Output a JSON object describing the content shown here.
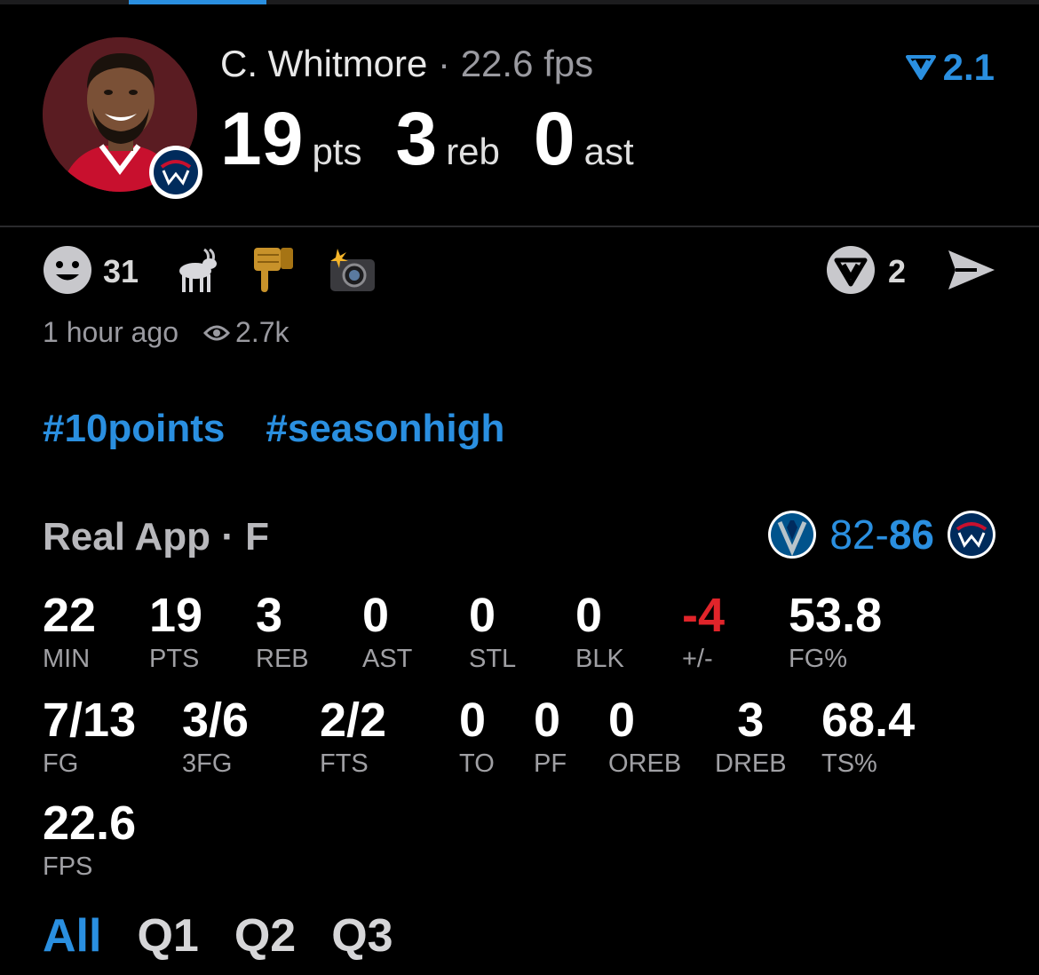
{
  "player": {
    "name": "C. Whitmore",
    "separator": " · ",
    "fps": "22.6 fps",
    "team_colors": {
      "jersey": "#c8102e",
      "badge": "#002b5c"
    }
  },
  "rating": {
    "icon": "real-app-v-icon",
    "value": "2.1"
  },
  "headline": [
    {
      "value": "19",
      "label": "pts"
    },
    {
      "value": "3",
      "label": "reb"
    },
    {
      "value": "0",
      "label": "ast"
    }
  ],
  "reactions": {
    "count": "31",
    "icons": [
      "smiley-icon",
      "goat-icon",
      "thumbs-down-icon",
      "camera-flash-icon"
    ],
    "comments": "2"
  },
  "meta": {
    "time": "1 hour ago",
    "views": "2.7k"
  },
  "hashtags": [
    "#10points",
    "#seasonhigh"
  ],
  "game": {
    "source": "Real App · F",
    "score_away": "82",
    "score_dash": "-",
    "score_home": "86",
    "away_team_icon": "mavericks-logo",
    "home_team_icon": "wizards-logo"
  },
  "stats_row1": [
    {
      "value": "22",
      "label": "MIN"
    },
    {
      "value": "19",
      "label": "PTS"
    },
    {
      "value": "3",
      "label": "REB"
    },
    {
      "value": "0",
      "label": "AST"
    },
    {
      "value": "0",
      "label": "STL"
    },
    {
      "value": "0",
      "label": "BLK"
    },
    {
      "value": "-4",
      "label": "+/-"
    },
    {
      "value": "53.8",
      "label": "FG%"
    }
  ],
  "stats_row2": [
    {
      "value": "7/13",
      "label": "FG"
    },
    {
      "value": "3/6",
      "label": "3FG"
    },
    {
      "value": "2/2",
      "label": "FTS"
    },
    {
      "value": "0",
      "label": "TO"
    },
    {
      "value": "0",
      "label": "PF"
    },
    {
      "value": "0",
      "label": "OREB"
    },
    {
      "value": "3",
      "label": "DREB"
    },
    {
      "value": "68.4",
      "label": "TS%"
    }
  ],
  "stats_row3": [
    {
      "value": "22.6",
      "label": "FPS"
    }
  ],
  "tabs": [
    "All",
    "Q1",
    "Q2",
    "Q3"
  ],
  "colors": {
    "accent": "#2a8fe0",
    "negative": "#e0242a",
    "background": "#000000"
  }
}
